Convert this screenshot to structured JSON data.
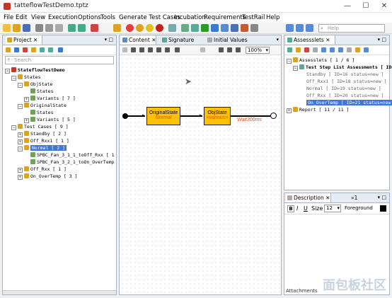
{
  "window": {
    "title": "tatteflowTestDemo.tptz",
    "minimize": "—",
    "maximize": "☐",
    "close": "✕"
  },
  "menu": [
    "File",
    "Edit",
    "View",
    "Execution",
    "Options",
    "Tools",
    "Generate Test Cases",
    "Incubation",
    "Requirements",
    "TestRail",
    "Help"
  ],
  "toolbar": {
    "search_placeholder": "Help"
  },
  "project": {
    "tab_label": "Project",
    "search_placeholder": "Search",
    "root": "StateflowTestDemo",
    "rows": [
      {
        "indent": 1,
        "text": "States",
        "exp": "−"
      },
      {
        "indent": 2,
        "text": "ObjState",
        "exp": "−"
      },
      {
        "indent": 3,
        "text": "States",
        "exp": ""
      },
      {
        "indent": 3,
        "text": "Variants  [ 7 ]",
        "exp": "+"
      },
      {
        "indent": 2,
        "text": "OriginalState",
        "exp": "−"
      },
      {
        "indent": 3,
        "text": "States",
        "exp": ""
      },
      {
        "indent": 3,
        "text": "Variants  [ 5 ]",
        "exp": "+"
      },
      {
        "indent": 1,
        "text": "Test Cases  [ 9 ]",
        "exp": "−"
      },
      {
        "indent": 2,
        "text": "Standby  [ 2 ]",
        "exp": "+"
      },
      {
        "indent": 2,
        "text": "Off_Rxx1  [ 1 ]",
        "exp": "+"
      },
      {
        "indent": 2,
        "text": "Normal  [ 2 ]",
        "exp": "−",
        "selected": true
      },
      {
        "indent": 3,
        "text": "SPBC_Fan_3_1_1_toOff_Rxx  [ 1",
        "exp": ""
      },
      {
        "indent": 3,
        "text": "SPBC_Fan_3_2_1_toOn_OverTemp",
        "exp": ""
      },
      {
        "indent": 2,
        "text": "Off_Rxx  [ 1 ]",
        "exp": "+"
      },
      {
        "indent": 2,
        "text": "On_OverTemp  [ 3 ]",
        "exp": "+"
      }
    ]
  },
  "editor": {
    "tabs": [
      "Content",
      "Signature",
      "Initial Values"
    ],
    "zoom": "100%",
    "states": [
      {
        "name": "OriginalState",
        "sub": "Normal"
      },
      {
        "name": "ObjState",
        "sub": "<various>"
      }
    ],
    "transition_label": "Wait300ms"
  },
  "assessment": {
    "tab_label": "Assessslets",
    "root": "Assesslets  [ 1 / 6 ]",
    "list": "Test Step List Assessments  [ ID=",
    "items": [
      {
        "text": "Standby  [ ID=16 status=new ]",
        "selected": false
      },
      {
        "text": "Off_Rxx1  [ ID=18 status=new ]",
        "selected": false
      },
      {
        "text": "Normal  [ ID=19 status=new ]",
        "selected": false
      },
      {
        "text": "Off_Rxx  [ ID=20 status=new ]",
        "selected": false
      },
      {
        "text": "On_OverTemp  [ ID=21 status=new ]",
        "selected": true
      }
    ],
    "report": "Report  [ 11 / 11 ]"
  },
  "description": {
    "tab_label": "Description",
    "tab2": "»1",
    "size_label": "Size",
    "size_value": "12",
    "fg_label": "Foreground"
  },
  "attachments": "Attachments",
  "watermark": "面包板社区",
  "colors": {
    "selection": "#3b78d8",
    "state_fill": "#ffc107",
    "state_sub": "#e0501a"
  }
}
